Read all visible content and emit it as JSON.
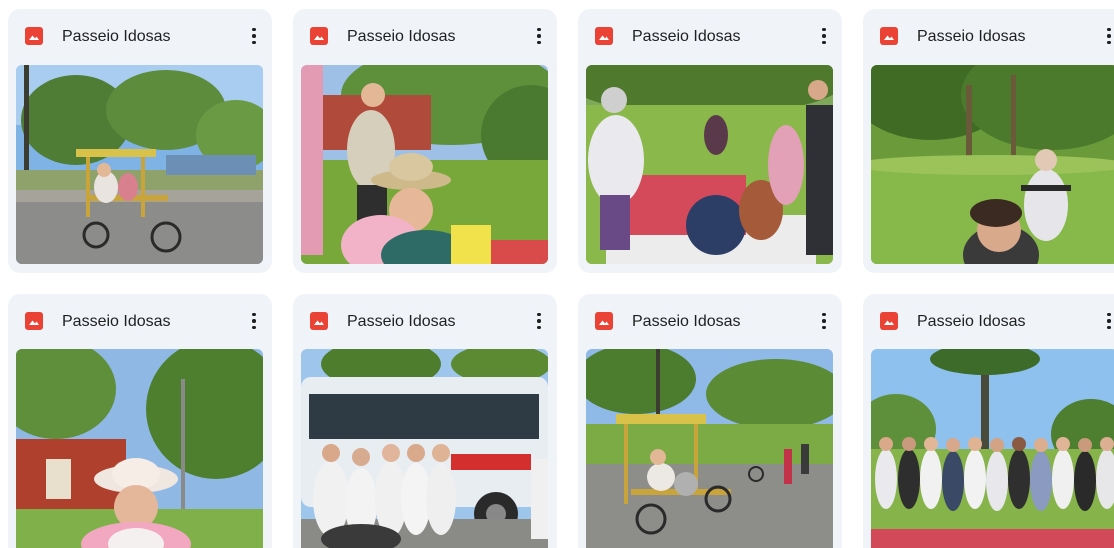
{
  "files": [
    {
      "title": "Passeio Idosas",
      "icon": "image-file-icon",
      "scene": "quadricycle"
    },
    {
      "title": "Passeio Idosas",
      "icon": "image-file-icon",
      "scene": "women-hat"
    },
    {
      "title": "Passeio Idosas",
      "icon": "image-file-icon",
      "scene": "picnic"
    },
    {
      "title": "Passeio Idosas",
      "icon": "image-file-icon",
      "scene": "park-wheelchair"
    },
    {
      "title": "Passeio Idosas",
      "icon": "image-file-icon",
      "scene": "woman-trees"
    },
    {
      "title": "Passeio Idosas",
      "icon": "image-file-icon",
      "scene": "bus-group"
    },
    {
      "title": "Passeio Idosas",
      "icon": "image-file-icon",
      "scene": "quadricycle-2"
    },
    {
      "title": "Passeio Idosas",
      "icon": "image-file-icon",
      "scene": "group-photo"
    }
  ],
  "colors": {
    "card_bg": "#f0f4f9",
    "icon_red": "#ea4335",
    "text": "#1f1f1f"
  }
}
